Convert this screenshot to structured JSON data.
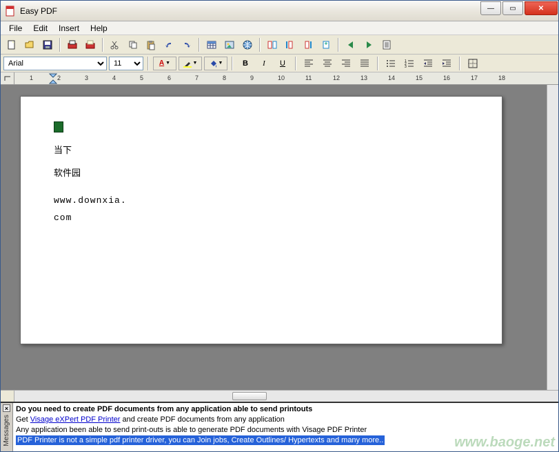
{
  "window": {
    "title": "Easy PDF"
  },
  "menu": {
    "items": [
      "File",
      "Edit",
      "Insert",
      "Help"
    ]
  },
  "format": {
    "font": "Arial",
    "size": "11",
    "bold": "B",
    "italic": "I",
    "underline": "U"
  },
  "ruler": {
    "marks": [
      "1",
      "2",
      "3",
      "4",
      "5",
      "6",
      "7",
      "8",
      "9",
      "10",
      "11",
      "12",
      "13",
      "14",
      "15",
      "16",
      "17",
      "18"
    ]
  },
  "document": {
    "line1": "当下",
    "line2": "软件园",
    "url1": "www.downxia.",
    "url2": "com"
  },
  "messages": {
    "tab_label": "Messages",
    "line1": "Do you need to create PDF documents from any application able to send printouts",
    "line2_a": "Get ",
    "line2_link": "Visage eXPert PDF Printer",
    "line2_b": " and create PDF documents from any application",
    "line3": "Any application been able to send print-outs is able to generate PDF documents with Visage PDF Printer",
    "line4": "PDF Printer is not a simple pdf printer driver, you can Join jobs, Create Outlines/ Hypertexts and many more.."
  },
  "watermark": {
    "text": "www.baoge.net"
  }
}
